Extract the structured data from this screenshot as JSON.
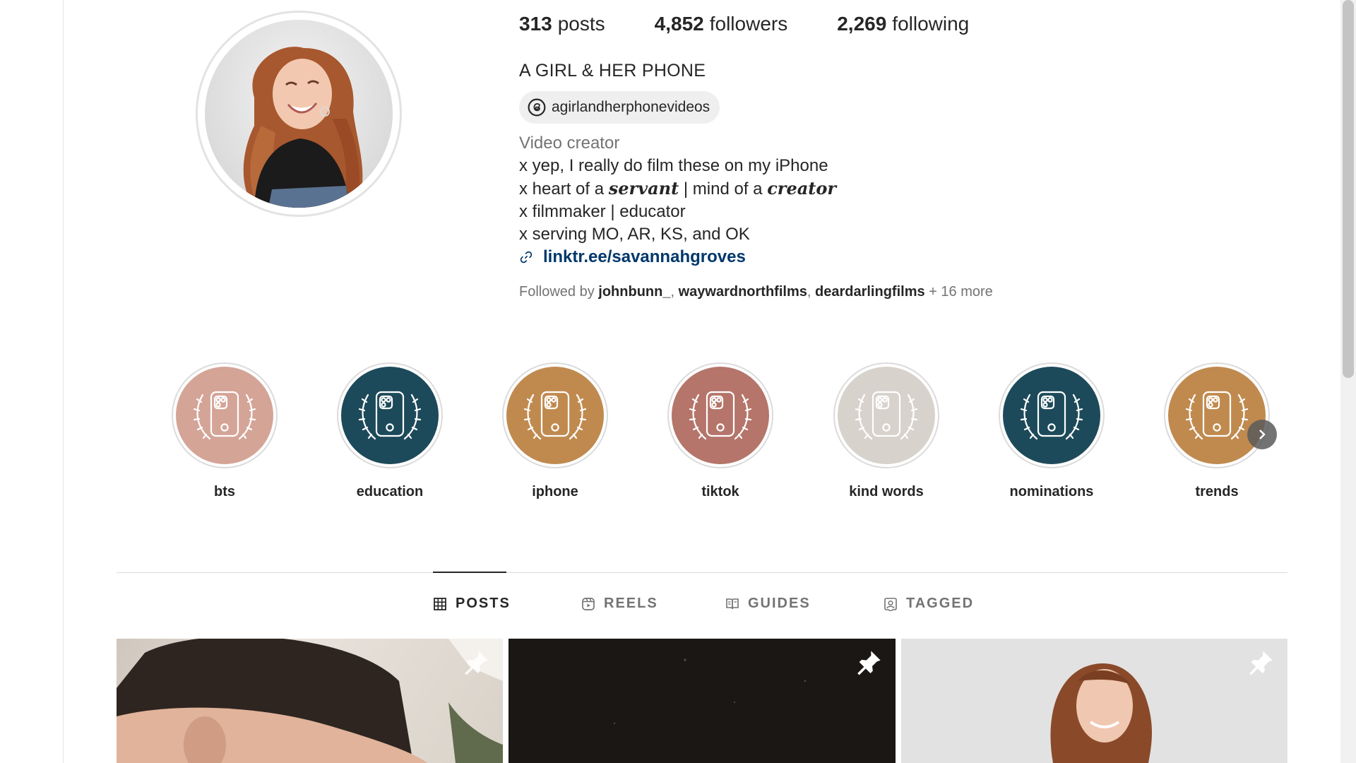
{
  "profile": {
    "stats": [
      {
        "count": "313",
        "label": "posts"
      },
      {
        "count": "4,852",
        "label": "followers"
      },
      {
        "count": "2,269",
        "label": "following"
      }
    ],
    "name": "A GIRL & HER PHONE",
    "threads_handle": "agirlandherphonevideos",
    "category": "Video creator",
    "bio": {
      "line1": "x yep, I really do film these on my iPhone",
      "line2_a": "x heart of a ",
      "line2_b": "servant",
      "line2_c": " | mind of a ",
      "line2_d": "creator",
      "line3": "x filmmaker | educator",
      "line4": "x serving MO, AR, KS, and OK"
    },
    "link": "linktr.ee/savannahgroves",
    "followed_by": {
      "prefix": "Followed by ",
      "accounts": [
        "johnbunn_",
        "waywardnorthfilms",
        "deardarlingfilms"
      ],
      "more": " + 16 more"
    }
  },
  "highlights": [
    {
      "label": "bts",
      "color": "#d4a497"
    },
    {
      "label": "education",
      "color": "#1d4a5a"
    },
    {
      "label": "iphone",
      "color": "#c08a4f"
    },
    {
      "label": "tiktok",
      "color": "#b5756a"
    },
    {
      "label": "kind words",
      "color": "#d8d2cc"
    },
    {
      "label": "nominations",
      "color": "#1d4a5a"
    },
    {
      "label": "trends",
      "color": "#c08a4f"
    }
  ],
  "tabs": [
    {
      "label": "POSTS",
      "icon": "grid-icon",
      "active": true
    },
    {
      "label": "REELS",
      "icon": "reels-icon",
      "active": false
    },
    {
      "label": "GUIDES",
      "icon": "guides-icon",
      "active": false
    },
    {
      "label": "TAGGED",
      "icon": "tagged-icon",
      "active": false
    }
  ]
}
